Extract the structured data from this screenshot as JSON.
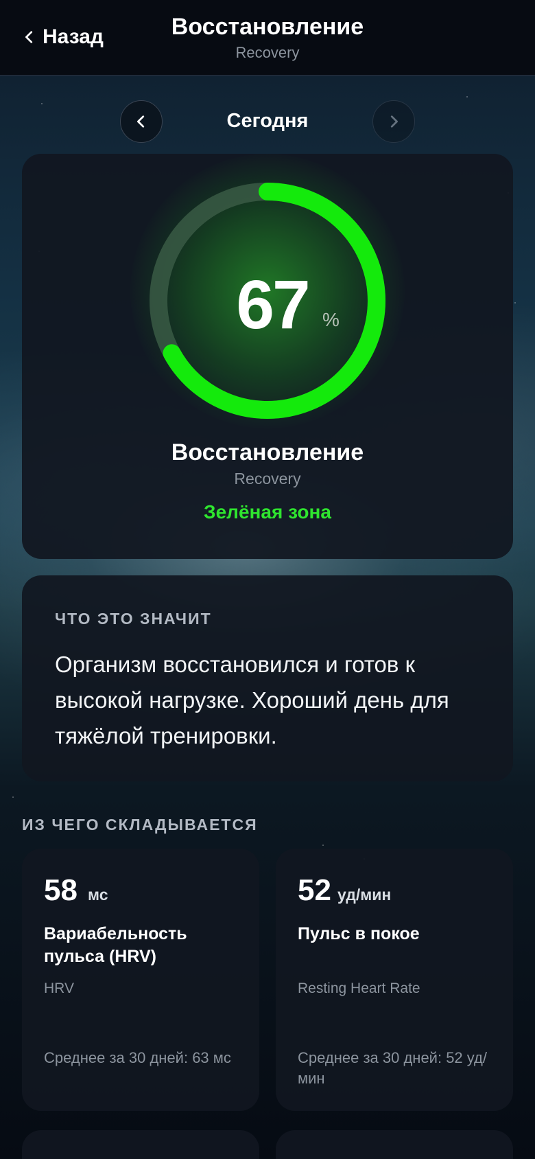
{
  "header": {
    "back_label": "Назад",
    "title": "Восстановление",
    "subtitle": "Recovery"
  },
  "date_nav": {
    "label": "Сегодня"
  },
  "score": {
    "value": "67",
    "unit": "%",
    "progress_fraction": 0.67,
    "title": "Восстановление",
    "subtitle": "Recovery",
    "zone": "Зелёная зона"
  },
  "meaning": {
    "heading": "ЧТО ЭТО ЗНАЧИТ",
    "text": "Организм восстановился и готов к высокой нагрузке. Хороший день для тяжёлой тренировки."
  },
  "components": {
    "heading": "ИЗ ЧЕГО СКЛАДЫВАЕТСЯ",
    "items": [
      {
        "value": "58",
        "unit": "мс",
        "name": "Вариабельность пульса (HRV)",
        "name_en": "HRV",
        "average": "Среднее за 30 дней: 63 мс"
      },
      {
        "value": "52",
        "unit": "уд/мин",
        "name": "Пульс в покое",
        "name_en": "Resting Heart Rate",
        "average": "Среднее за 30 дней: 52 уд/мин"
      }
    ]
  },
  "colors": {
    "accent_green": "#2fe52f",
    "ring_track": "#3a5a44",
    "card_bg": "#11171f"
  },
  "icons": {
    "back": "chevron-left-icon",
    "prev": "chevron-left-icon",
    "next": "chevron-right-icon"
  }
}
